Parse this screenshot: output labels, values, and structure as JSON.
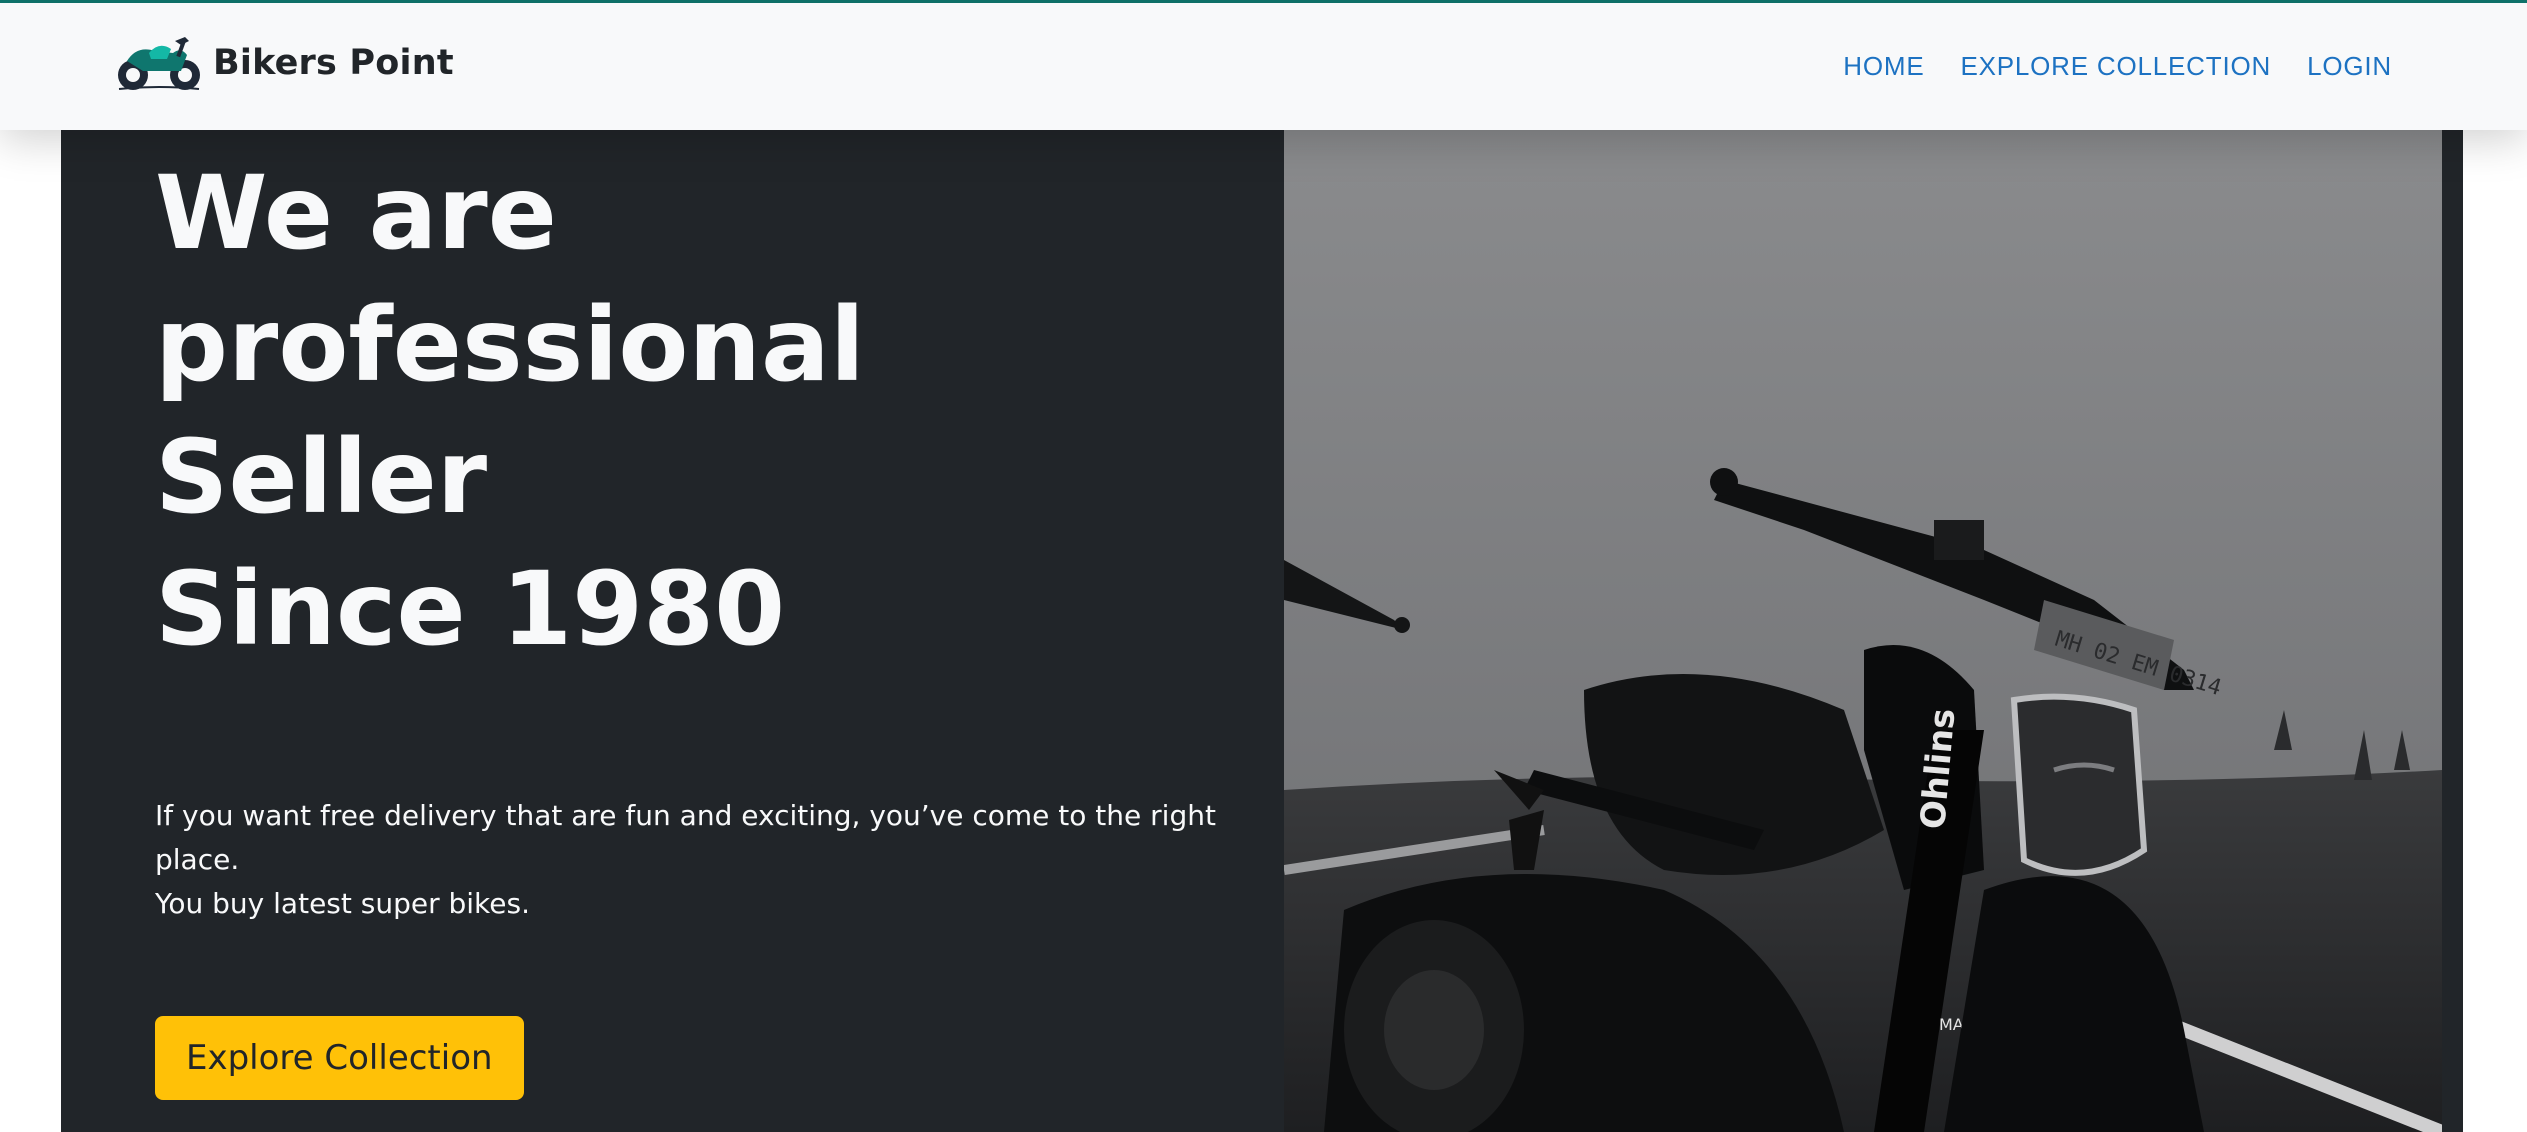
{
  "brand": {
    "name": "Bikers Point",
    "logo_icon": "motorcycle-logo-icon",
    "accent_color": "#0f766e"
  },
  "nav": {
    "items": [
      {
        "label": "HOME"
      },
      {
        "label": "EXPLORE COLLECTION"
      },
      {
        "label": "LOGIN"
      }
    ],
    "link_color": "#1d72c2"
  },
  "hero": {
    "title_lines": [
      "We are",
      "professional",
      "Seller",
      "Since 1980"
    ],
    "description_lines": [
      "If you want free delivery that are fun and exciting, you’ve come to the right place.",
      "You buy latest super bikes."
    ],
    "cta_label": "Explore Collection",
    "background_color": "#212529",
    "cta_color": "#ffc107",
    "image": "motorcycle-photo",
    "image_plate_text": "MH 02 EM 0314",
    "image_brand_text": "MAGURA"
  }
}
